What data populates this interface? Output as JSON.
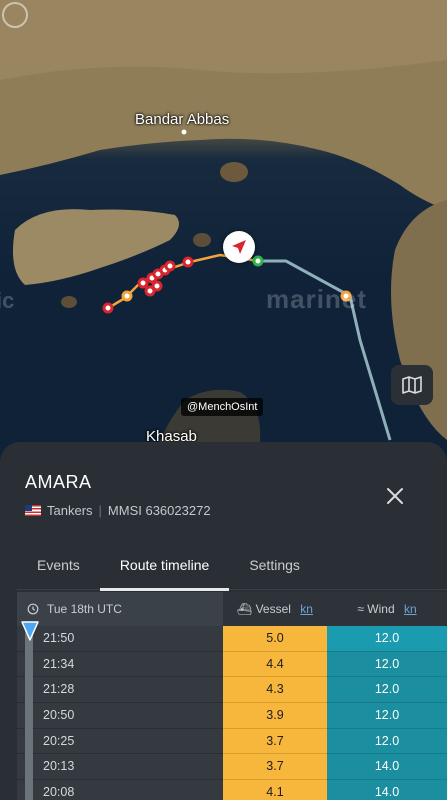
{
  "map": {
    "labels": {
      "city1": "Bandar Abbas",
      "city2": "Khasab",
      "watermark": "marinet",
      "watermark_left": "ic",
      "credit": "@MenchOsInt"
    }
  },
  "vessel": {
    "name": "AMARA",
    "type": "Tankers",
    "mmsi_label": "MMSI 636023272",
    "flag": "liberia-flag"
  },
  "tabs": [
    "Events",
    "Route timeline",
    "Settings"
  ],
  "active_tab": "Route timeline",
  "timeline": {
    "date_label": "Tue 18th UTC",
    "vessel_col": "Vessel",
    "wind_col": "Wind",
    "unit": "kn",
    "rows": [
      {
        "time": "21:50",
        "vessel": "5.0",
        "wind": "12.0"
      },
      {
        "time": "21:34",
        "vessel": "4.4",
        "wind": "12.0"
      },
      {
        "time": "21:28",
        "vessel": "4.3",
        "wind": "12.0"
      },
      {
        "time": "20:50",
        "vessel": "3.9",
        "wind": "12.0"
      },
      {
        "time": "20:25",
        "vessel": "3.7",
        "wind": "12.0"
      },
      {
        "time": "20:13",
        "vessel": "3.7",
        "wind": "14.0"
      },
      {
        "time": "20:08",
        "vessel": "4.1",
        "wind": "14.0"
      }
    ]
  },
  "colors": {
    "vessel_cell": "#f7b63c",
    "wind_cell": "#1b8fa0",
    "track_orange": "#f5a33b",
    "track_red": "#d8252e",
    "route_line": "#8fb0b8"
  }
}
